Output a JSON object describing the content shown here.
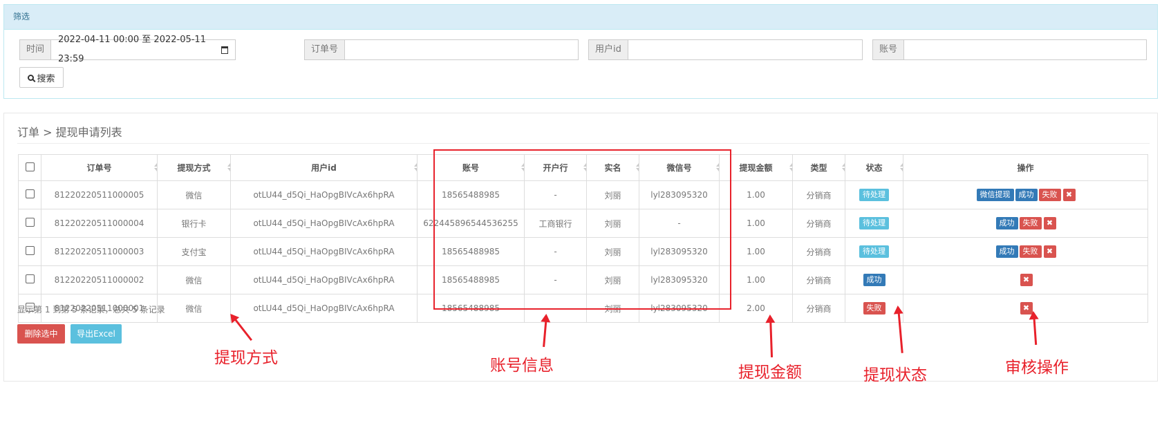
{
  "filter": {
    "title": "筛选",
    "time_label": "时间",
    "time_value": "2022-04-11 00:00 至 2022-05-11 23:59",
    "order_label": "订单号",
    "user_label": "用户id",
    "account_label": "账号",
    "search_label": "搜索"
  },
  "breadcrumb": "订单 > 提现申请列表",
  "table": {
    "headers": [
      "订单号",
      "提现方式",
      "用户id",
      "账号",
      "开户行",
      "实名",
      "微信号",
      "提现金额",
      "类型",
      "状态",
      "操作"
    ],
    "rows": [
      {
        "order": "81220220511000005",
        "method": "微信",
        "user": "otLU44_d5Qi_HaOpgBIVcAx6hpRA",
        "account": "18565488985",
        "bank": "-",
        "name": "刘丽",
        "wechat": "lyl283095320",
        "amount": "1.00",
        "type": "分销商",
        "status": "待处理",
        "actions": [
          "微信提现",
          "成功",
          "失败"
        ]
      },
      {
        "order": "81220220511000004",
        "method": "银行卡",
        "user": "otLU44_d5Qi_HaOpgBIVcAx6hpRA",
        "account": "622445896544536255",
        "bank": "工商银行",
        "name": "刘丽",
        "wechat": "-",
        "amount": "1.00",
        "type": "分销商",
        "status": "待处理",
        "actions": [
          "成功",
          "失败"
        ]
      },
      {
        "order": "81220220511000003",
        "method": "支付宝",
        "user": "otLU44_d5Qi_HaOpgBIVcAx6hpRA",
        "account": "18565488985",
        "bank": "-",
        "name": "刘丽",
        "wechat": "lyl283095320",
        "amount": "1.00",
        "type": "分销商",
        "status": "待处理",
        "actions": [
          "成功",
          "失败"
        ]
      },
      {
        "order": "81220220511000002",
        "method": "微信",
        "user": "otLU44_d5Qi_HaOpgBIVcAx6hpRA",
        "account": "18565488985",
        "bank": "-",
        "name": "刘丽",
        "wechat": "lyl283095320",
        "amount": "1.00",
        "type": "分销商",
        "status": "成功",
        "actions": []
      },
      {
        "order": "81220220511000001",
        "method": "微信",
        "user": "otLU44_d5Qi_HaOpgBIVcAx6hpRA",
        "account": "18565488985",
        "bank": "-",
        "name": "刘丽",
        "wechat": "lyl283095320",
        "amount": "2.00",
        "type": "分销商",
        "status": "失败",
        "actions": []
      }
    ]
  },
  "summary": "显示第 1 到第 5 条记录，总共 5 条记录",
  "buttons": {
    "delete": "删除选中",
    "export": "导出Excel"
  },
  "annotations": {
    "method": "提现方式",
    "account_info": "账号信息",
    "amount": "提现金额",
    "status": "提现状态",
    "actions": "审核操作"
  },
  "colors": {
    "annotation": "#e8212b",
    "pending": "#5bc0de",
    "success": "#337ab7",
    "fail": "#d9534f"
  },
  "icons": {
    "calendar": "calendar-icon",
    "search": "search-icon",
    "delete": "close-icon"
  }
}
